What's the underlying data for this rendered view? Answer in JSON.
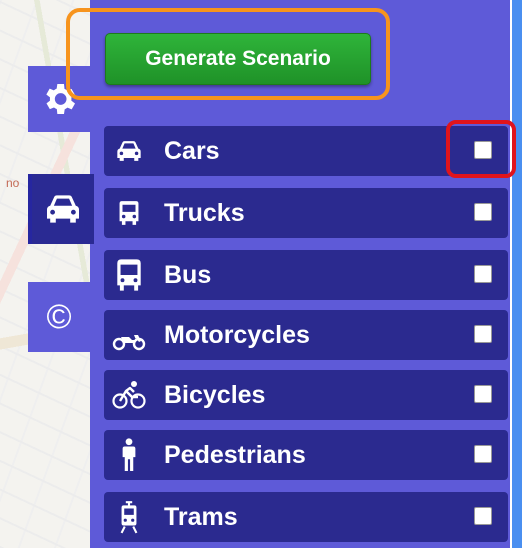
{
  "generate_button": {
    "label": "Generate Scenario"
  },
  "tabs": [
    {
      "name": "settings",
      "icon": "gear-icon"
    },
    {
      "name": "vehicles",
      "icon": "car-icon",
      "active": true
    },
    {
      "name": "copyright",
      "icon": "copyright-icon",
      "glyph": "©"
    }
  ],
  "vehicles": [
    {
      "label": "Cars",
      "icon": "car-icon",
      "checked": false
    },
    {
      "label": "Trucks",
      "icon": "truck-icon",
      "checked": false
    },
    {
      "label": "Bus",
      "icon": "bus-icon",
      "checked": false
    },
    {
      "label": "Motorcycles",
      "icon": "motorcycle-icon",
      "checked": false
    },
    {
      "label": "Bicycles",
      "icon": "bicycle-icon",
      "checked": false
    },
    {
      "label": "Pedestrians",
      "icon": "pedestrian-icon",
      "checked": false
    },
    {
      "label": "Trams",
      "icon": "tram-icon",
      "checked": false
    }
  ],
  "colors": {
    "panel": "#5e5ad8",
    "row": "#2b2a8f",
    "button": "#22a22e",
    "highlight_orange": "#f7941d",
    "highlight_red": "#e0141c"
  }
}
